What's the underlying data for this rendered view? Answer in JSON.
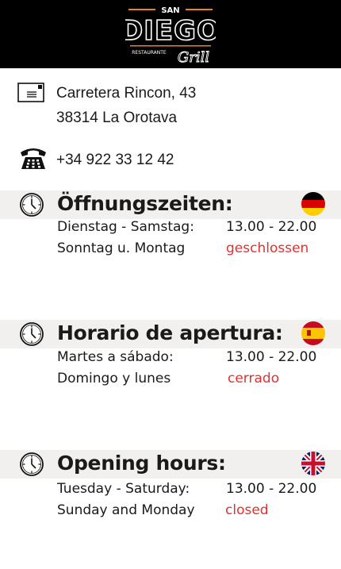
{
  "header": {
    "logo_top": "SAN",
    "logo_main": "DIEGO",
    "logo_small": "RESTAURANTE",
    "logo_script": "Grill"
  },
  "contact": {
    "address_line1": "Carretera Rincon, 43",
    "address_line2": "38314 La Orotava",
    "phone": "+34 922 33 12 42"
  },
  "sections": [
    {
      "title": "Öffnungszeiten:",
      "rows": [
        {
          "days": "Dienstag - Samstag:",
          "hours": "13.00 - 22.00"
        },
        {
          "days": "Sonntag u. Montag",
          "hours": "geschlossen"
        }
      ]
    },
    {
      "title": "Horario de apertura:",
      "rows": [
        {
          "days": "Martes a sábado:",
          "hours": "13.00 - 22.00"
        },
        {
          "days": "Domingo y lunes",
          "hours": "cerrado"
        }
      ]
    },
    {
      "title": "Opening hours:",
      "rows": [
        {
          "days": "Tuesday - Saturday:",
          "hours": "13.00 - 22.00"
        },
        {
          "days": "Sunday and Monday",
          "hours": "closed"
        }
      ]
    }
  ],
  "colors": {
    "closed_text": "#e03030",
    "header_bg": "#000000",
    "band_bg": "#f2f0ee",
    "logo_orange": "#e8841a"
  },
  "icons": [
    "envelope-icon",
    "phone-icon",
    "clock-icon",
    "german-flag-icon",
    "spanish-flag-icon",
    "uk-flag-icon"
  ]
}
